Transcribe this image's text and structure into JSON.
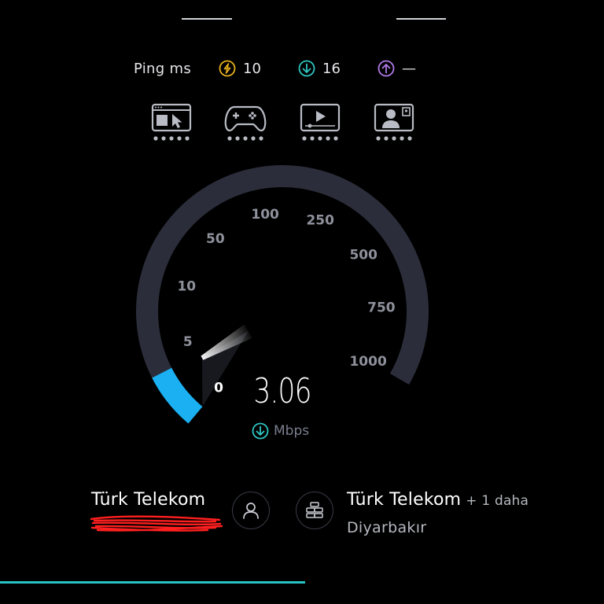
{
  "ping": {
    "label": "Ping ms",
    "jitter": "10",
    "download": "16",
    "upload": "—",
    "jitter_icon": "lightning-circle-icon",
    "download_icon": "arrow-down-circle-icon",
    "upload_icon": "arrow-up-circle-icon"
  },
  "categories": [
    {
      "icon": "browsing-icon"
    },
    {
      "icon": "gamepad-icon"
    },
    {
      "icon": "video-play-icon"
    },
    {
      "icon": "video-call-icon"
    }
  ],
  "gauge": {
    "ticks": [
      "0",
      "5",
      "10",
      "50",
      "100",
      "250",
      "500",
      "750",
      "1000"
    ],
    "needle_value": 3.06
  },
  "result": {
    "value": "3.06",
    "unit": "Mbps"
  },
  "provider": {
    "isp": "Türk Telekom",
    "server_isp": "Türk Telekom",
    "more": "+ 1 daha",
    "city": "Diyarbakır"
  },
  "progress": 0.505,
  "colors": {
    "background": "#000000",
    "arc_track": "#2b2d3a",
    "arc_fill": "#1ab0f2",
    "jitter": "#e8b21c",
    "download": "#2fc7c3",
    "upload": "#b07ae8",
    "progress": "#26c2c2",
    "scribble": "#ff1f1f"
  }
}
